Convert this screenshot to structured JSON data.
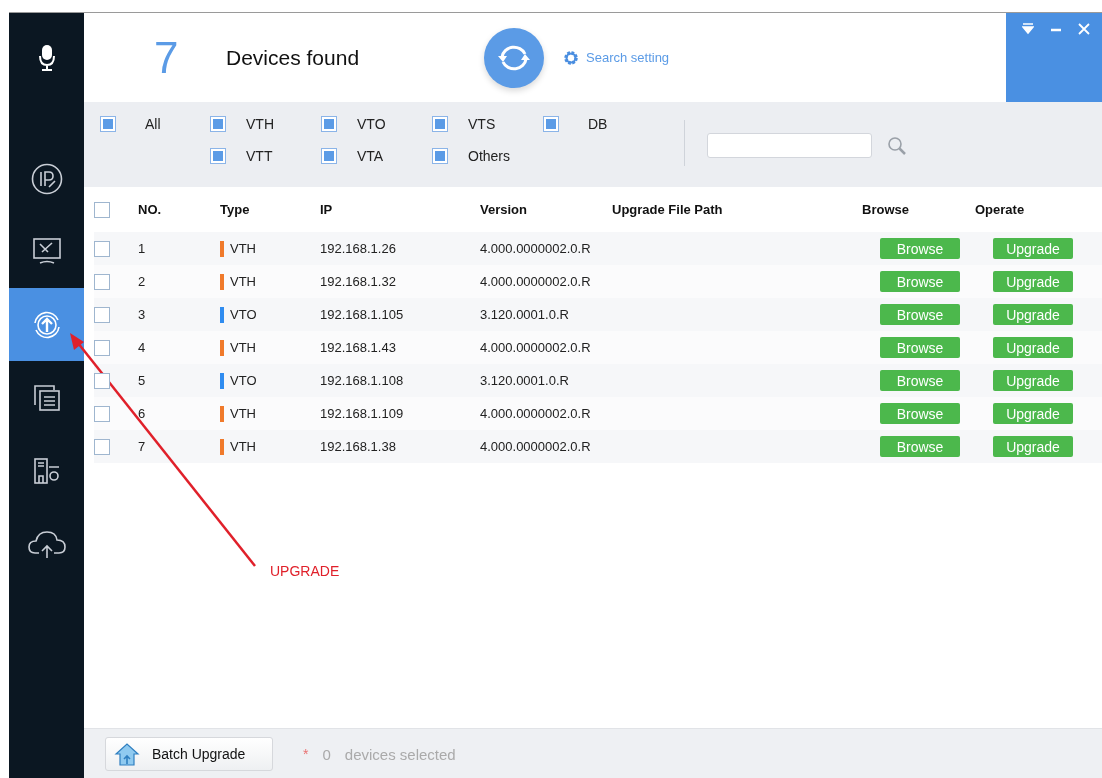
{
  "sidebar": {
    "items": [
      {
        "kind": "mic",
        "selected": false
      },
      {
        "kind": "ip",
        "selected": false
      },
      {
        "kind": "tools",
        "selected": false
      },
      {
        "kind": "upgrade",
        "selected": true
      },
      {
        "kind": "windows",
        "selected": false
      },
      {
        "kind": "building",
        "selected": false
      },
      {
        "kind": "cloud",
        "selected": false
      }
    ]
  },
  "header": {
    "count": "7",
    "title": "Devices found",
    "search_setting": "Search setting"
  },
  "filters": {
    "all": {
      "label": "All",
      "checked": true
    },
    "groups": [
      [
        {
          "label": "VTH",
          "checked": true
        },
        {
          "label": "VTT",
          "checked": true
        }
      ],
      [
        {
          "label": "VTO",
          "checked": true
        },
        {
          "label": "VTA",
          "checked": true
        }
      ],
      [
        {
          "label": "VTS",
          "checked": true
        },
        {
          "label": "Others",
          "checked": true
        }
      ],
      [
        {
          "label": "DB",
          "checked": true
        }
      ]
    ]
  },
  "table": {
    "select_all_checked": false,
    "columns": [
      "NO.",
      "Type",
      "IP",
      "Version",
      "Upgrade File Path",
      "Browse",
      "Operate"
    ],
    "rows": [
      {
        "no": "1",
        "type": "VTH",
        "color": "#f07a2b",
        "ip": "192.168.1.26",
        "version": "4.000.0000002.0.R",
        "checked": false,
        "browse": "Browse",
        "operate": "Upgrade"
      },
      {
        "no": "2",
        "type": "VTH",
        "color": "#f07a2b",
        "ip": "192.168.1.32",
        "version": "4.000.0000002.0.R",
        "checked": false,
        "browse": "Browse",
        "operate": "Upgrade"
      },
      {
        "no": "3",
        "type": "VTO",
        "color": "#2f8cf0",
        "ip": "192.168.1.105",
        "version": "3.120.0001.0.R",
        "checked": false,
        "browse": "Browse",
        "operate": "Upgrade"
      },
      {
        "no": "4",
        "type": "VTH",
        "color": "#f07a2b",
        "ip": "192.168.1.43",
        "version": "4.000.0000002.0.R",
        "checked": false,
        "browse": "Browse",
        "operate": "Upgrade"
      },
      {
        "no": "5",
        "type": "VTO",
        "color": "#2f8cf0",
        "ip": "192.168.1.108",
        "version": "3.120.0001.0.R",
        "checked": false,
        "browse": "Browse",
        "operate": "Upgrade"
      },
      {
        "no": "6",
        "type": "VTH",
        "color": "#f07a2b",
        "ip": "192.168.1.109",
        "version": "4.000.0000002.0.R",
        "checked": false,
        "browse": "Browse",
        "operate": "Upgrade"
      },
      {
        "no": "7",
        "type": "VTH",
        "color": "#f07a2b",
        "ip": "192.168.1.38",
        "version": "4.000.0000002.0.R",
        "checked": false,
        "browse": "Browse",
        "operate": "Upgrade"
      }
    ]
  },
  "footer": {
    "button": "Batch Upgrade",
    "asterisk": "*",
    "count": "0",
    "note": "devices selected"
  },
  "annotation": {
    "label": "UPGRADE"
  }
}
